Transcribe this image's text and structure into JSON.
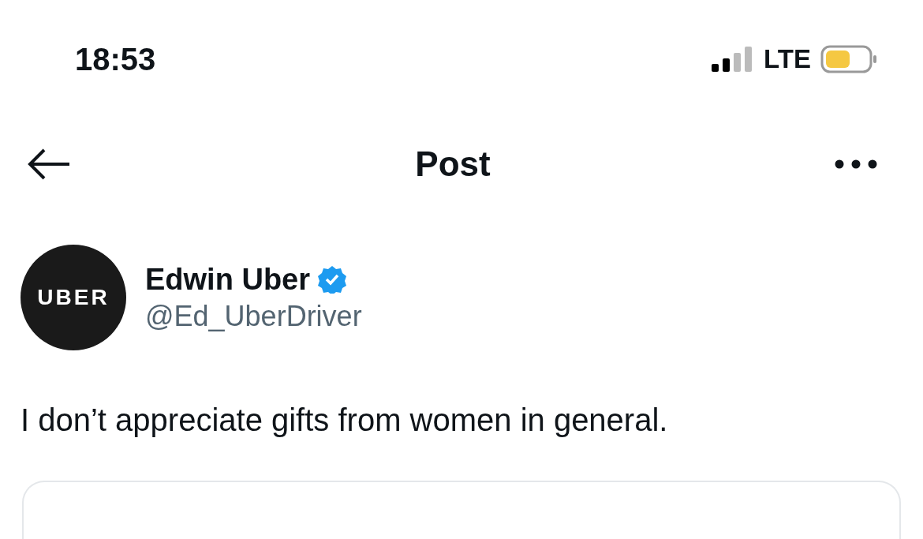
{
  "status_bar": {
    "time": "18:53",
    "network": "LTE"
  },
  "header": {
    "title": "Post"
  },
  "post": {
    "avatar_text": "UBER",
    "name": "Edwin Uber",
    "verified": true,
    "handle": "@Ed_UberDriver",
    "text": "I don’t appreciate gifts from women in general."
  }
}
